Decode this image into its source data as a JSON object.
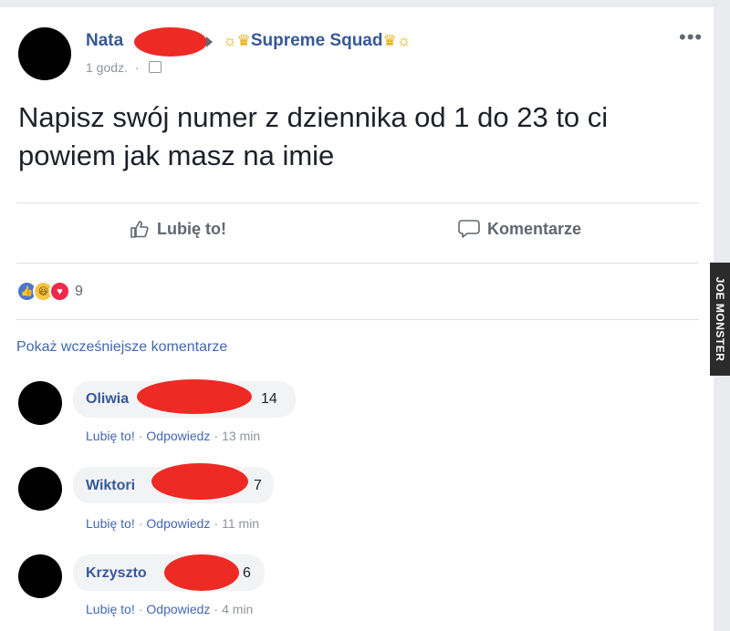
{
  "post": {
    "author_name": "Nata",
    "group_name": "Supreme Squad",
    "deco_left": "☼♛",
    "deco_right": "♛☼",
    "time": "1 godz.",
    "more": "•••",
    "text": "Napisz swój numer z dziennika od 1 do 23 to ci powiem jak masz na imie"
  },
  "actions": {
    "like_label": "Lubię to!",
    "comment_label": "Komentarze"
  },
  "reactions": {
    "count": "9"
  },
  "comments_section": {
    "show_previous_label": "Pokaż wcześniejsze komentarze"
  },
  "comments": [
    {
      "name": "Oliwia",
      "text": "14",
      "like": "Lubię to!",
      "reply": "Odpowiedz",
      "time": "13 min"
    },
    {
      "name": "Wiktori",
      "text": "7",
      "like": "Lubię to!",
      "reply": "Odpowiedz",
      "time": "11 min"
    },
    {
      "name": "Krzyszto",
      "text": "6",
      "like": "Lubię to!",
      "reply": "Odpowiedz",
      "time": "4 min"
    }
  ],
  "watermark": "JOE MONSTER",
  "colors": {
    "link": "#365899",
    "redaction": "#ee2a24",
    "muted": "#90949c"
  }
}
